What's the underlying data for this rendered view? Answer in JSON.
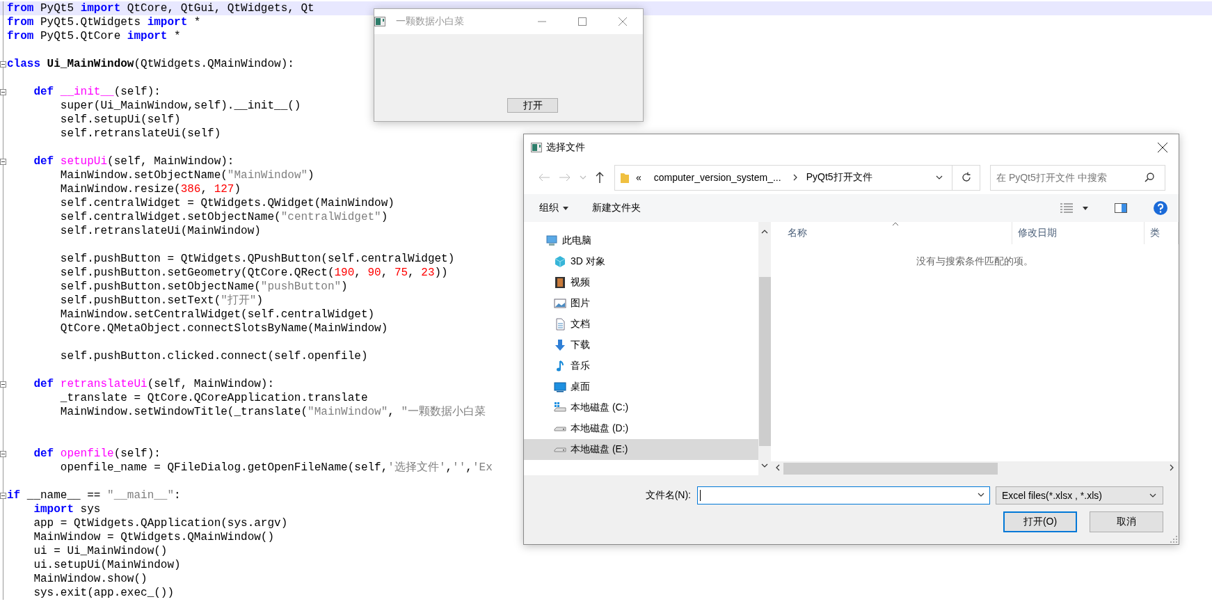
{
  "editor": {
    "lines": [
      {
        "current": true,
        "fold": false,
        "segments": [
          {
            "kind": "keyword",
            "text": "from"
          },
          {
            "kind": "plain",
            "text": " PyQt5 "
          },
          {
            "kind": "keyword",
            "text": "import"
          },
          {
            "kind": "plain",
            "text": " QtCore, QtGui, QtWidgets, Qt"
          }
        ]
      },
      {
        "current": false,
        "fold": false,
        "segments": [
          {
            "kind": "keyword",
            "text": "from"
          },
          {
            "kind": "plain",
            "text": " PyQt5.QtWidgets "
          },
          {
            "kind": "keyword",
            "text": "import"
          },
          {
            "kind": "plain",
            "text": " *"
          }
        ]
      },
      {
        "current": false,
        "fold": false,
        "segments": [
          {
            "kind": "keyword",
            "text": "from"
          },
          {
            "kind": "plain",
            "text": " PyQt5.QtCore "
          },
          {
            "kind": "keyword",
            "text": "import"
          },
          {
            "kind": "plain",
            "text": " *"
          }
        ]
      },
      {
        "current": false,
        "fold": false
      },
      {
        "current": false,
        "fold": true,
        "segments": [
          {
            "kind": "keyword",
            "text": "class "
          },
          {
            "kind": "classname",
            "text": "Ui_MainWindow"
          },
          {
            "kind": "plain",
            "text": "(QtWidgets.QMainWindow):"
          }
        ]
      },
      {
        "current": false,
        "fold": false
      },
      {
        "current": false,
        "fold": true,
        "segments": [
          {
            "kind": "keyword",
            "text": "    def "
          },
          {
            "kind": "function",
            "text": "__init__"
          },
          {
            "kind": "plain",
            "text": "(self):"
          }
        ]
      },
      {
        "current": false,
        "fold": false,
        "segments": [
          {
            "kind": "plain",
            "text": "        super(Ui_MainWindow,self).__init__()"
          }
        ]
      },
      {
        "current": false,
        "fold": false,
        "segments": [
          {
            "kind": "plain",
            "text": "        self.setupUi(self)"
          }
        ]
      },
      {
        "current": false,
        "fold": false,
        "segments": [
          {
            "kind": "plain",
            "text": "        self.retranslateUi(self)"
          }
        ]
      },
      {
        "current": false,
        "fold": false
      },
      {
        "current": false,
        "fold": true,
        "segments": [
          {
            "kind": "keyword",
            "text": "    def "
          },
          {
            "kind": "function",
            "text": "setupUi"
          },
          {
            "kind": "plain",
            "text": "(self, MainWindow):"
          }
        ]
      },
      {
        "current": false,
        "fold": false,
        "segments": [
          {
            "kind": "plain",
            "text": "        MainWindow.setObjectName("
          },
          {
            "kind": "string",
            "text": "\"MainWindow\""
          },
          {
            "kind": "plain",
            "text": ")"
          }
        ]
      },
      {
        "current": false,
        "fold": false,
        "segments": [
          {
            "kind": "plain",
            "text": "        MainWindow.resize("
          },
          {
            "kind": "number",
            "text": "386"
          },
          {
            "kind": "plain",
            "text": ", "
          },
          {
            "kind": "number",
            "text": "127"
          },
          {
            "kind": "plain",
            "text": ")"
          }
        ]
      },
      {
        "current": false,
        "fold": false,
        "segments": [
          {
            "kind": "plain",
            "text": "        self.centralWidget = QtWidgets.QWidget(MainWindow)"
          }
        ]
      },
      {
        "current": false,
        "fold": false,
        "segments": [
          {
            "kind": "plain",
            "text": "        self.centralWidget.setObjectName("
          },
          {
            "kind": "string",
            "text": "\"centralWidget\""
          },
          {
            "kind": "plain",
            "text": ")"
          }
        ]
      },
      {
        "current": false,
        "fold": false,
        "segments": [
          {
            "kind": "plain",
            "text": "        self.retranslateUi(MainWindow)"
          }
        ]
      },
      {
        "current": false,
        "fold": false
      },
      {
        "current": false,
        "fold": false,
        "segments": [
          {
            "kind": "plain",
            "text": "        self.pushButton = QtWidgets.QPushButton(self.centralWidget)"
          }
        ]
      },
      {
        "current": false,
        "fold": false,
        "segments": [
          {
            "kind": "plain",
            "text": "        self.pushButton.setGeometry(QtCore.QRect("
          },
          {
            "kind": "number",
            "text": "190"
          },
          {
            "kind": "plain",
            "text": ", "
          },
          {
            "kind": "number",
            "text": "90"
          },
          {
            "kind": "plain",
            "text": ", "
          },
          {
            "kind": "number",
            "text": "75"
          },
          {
            "kind": "plain",
            "text": ", "
          },
          {
            "kind": "number",
            "text": "23"
          },
          {
            "kind": "plain",
            "text": "))"
          }
        ]
      },
      {
        "current": false,
        "fold": false,
        "segments": [
          {
            "kind": "plain",
            "text": "        self.pushButton.setObjectName("
          },
          {
            "kind": "string",
            "text": "\"pushButton\""
          },
          {
            "kind": "plain",
            "text": ")"
          }
        ]
      },
      {
        "current": false,
        "fold": false,
        "segments": [
          {
            "kind": "plain",
            "text": "        self.pushButton.setText("
          },
          {
            "kind": "string",
            "text": "\"打开\""
          },
          {
            "kind": "plain",
            "text": ")"
          }
        ]
      },
      {
        "current": false,
        "fold": false,
        "segments": [
          {
            "kind": "plain",
            "text": "        MainWindow.setCentralWidget(self.centralWidget)"
          }
        ]
      },
      {
        "current": false,
        "fold": false,
        "segments": [
          {
            "kind": "plain",
            "text": "        QtCore.QMetaObject.connectSlotsByName(MainWindow)"
          }
        ]
      },
      {
        "current": false,
        "fold": false
      },
      {
        "current": false,
        "fold": false,
        "segments": [
          {
            "kind": "plain",
            "text": "        self.pushButton.clicked.connect(self.openfile)"
          }
        ]
      },
      {
        "current": false,
        "fold": false
      },
      {
        "current": false,
        "fold": true,
        "segments": [
          {
            "kind": "keyword",
            "text": "    def "
          },
          {
            "kind": "function",
            "text": "retranslateUi"
          },
          {
            "kind": "plain",
            "text": "(self, MainWindow):"
          }
        ]
      },
      {
        "current": false,
        "fold": false,
        "segments": [
          {
            "kind": "plain",
            "text": "        _translate = QtCore.QCoreApplication.translate"
          }
        ]
      },
      {
        "current": false,
        "fold": false,
        "segments": [
          {
            "kind": "plain",
            "text": "        MainWindow.setWindowTitle(_translate("
          },
          {
            "kind": "string",
            "text": "\"MainWindow\""
          },
          {
            "kind": "plain",
            "text": ", "
          },
          {
            "kind": "string",
            "text": "\"一颗数据小白菜"
          }
        ]
      },
      {
        "current": false,
        "fold": false
      },
      {
        "current": false,
        "fold": false
      },
      {
        "current": false,
        "fold": true,
        "segments": [
          {
            "kind": "keyword",
            "text": "    def "
          },
          {
            "kind": "function",
            "text": "openfile"
          },
          {
            "kind": "plain",
            "text": "(self):"
          }
        ]
      },
      {
        "current": false,
        "fold": false,
        "segments": [
          {
            "kind": "plain",
            "text": "        openfile_name = QFileDialog.getOpenFileName(self,"
          },
          {
            "kind": "string",
            "text": "'选择文件'"
          },
          {
            "kind": "plain",
            "text": ","
          },
          {
            "kind": "string",
            "text": "''"
          },
          {
            "kind": "plain",
            "text": ","
          },
          {
            "kind": "string",
            "text": "'Ex"
          }
        ]
      },
      {
        "current": false,
        "fold": false
      },
      {
        "current": false,
        "fold": true,
        "segments": [
          {
            "kind": "keyword",
            "text": "if"
          },
          {
            "kind": "plain",
            "text": " __name__ == "
          },
          {
            "kind": "string",
            "text": "\"__main__\""
          },
          {
            "kind": "plain",
            "text": ":"
          }
        ]
      },
      {
        "current": false,
        "fold": false,
        "segments": [
          {
            "kind": "keyword",
            "text": "    import"
          },
          {
            "kind": "plain",
            "text": " sys"
          }
        ]
      },
      {
        "current": false,
        "fold": false,
        "segments": [
          {
            "kind": "plain",
            "text": "    app = QtWidgets.QApplication(sys.argv)"
          }
        ]
      },
      {
        "current": false,
        "fold": false,
        "segments": [
          {
            "kind": "plain",
            "text": "    MainWindow = QtWidgets.QMainWindow()"
          }
        ]
      },
      {
        "current": false,
        "fold": false,
        "segments": [
          {
            "kind": "plain",
            "text": "    ui = Ui_MainWindow()"
          }
        ]
      },
      {
        "current": false,
        "fold": false,
        "segments": [
          {
            "kind": "plain",
            "text": "    ui.setupUi(MainWindow)"
          }
        ]
      },
      {
        "current": false,
        "fold": false,
        "segments": [
          {
            "kind": "plain",
            "text": "    MainWindow.show()"
          }
        ]
      },
      {
        "current": false,
        "fold": false,
        "segments": [
          {
            "kind": "plain",
            "text": "    sys.exit(app.exec_())"
          }
        ]
      }
    ]
  },
  "app_window": {
    "title": "一颗数据小白菜",
    "button": "打开"
  },
  "file_dialog": {
    "title": "选择文件",
    "address": {
      "overflow": "«",
      "crumbs": [
        "computer_version_system_...",
        "PyQt5打开文件"
      ]
    },
    "search": {
      "placeholder": "在 PyQt5打开文件 中搜索"
    },
    "toolbar": [
      {
        "label": "组织",
        "dropdown": true
      },
      {
        "label": "新建文件夹",
        "dropdown": false
      }
    ],
    "nav": [
      {
        "label": "此电脑",
        "selected": false,
        "children": [
          {
            "label": "3D 对象",
            "selected": false
          },
          {
            "label": "视频",
            "selected": false
          },
          {
            "label": "图片",
            "selected": false
          },
          {
            "label": "文档",
            "selected": false
          },
          {
            "label": "下载",
            "selected": false
          },
          {
            "label": "音乐",
            "selected": false
          },
          {
            "label": "桌面",
            "selected": false
          },
          {
            "label": "本地磁盘 (C:)",
            "selected": false
          },
          {
            "label": "本地磁盘 (D:)",
            "selected": false
          },
          {
            "label": "本地磁盘 (E:)",
            "selected": true
          }
        ]
      }
    ],
    "columns": [
      "名称",
      "修改日期",
      "类"
    ],
    "empty_message": "没有与搜索条件匹配的项。",
    "filename_label": "文件名(N):",
    "filetype": "Excel files(*.xlsx , *.xls)",
    "buttons": [
      {
        "label": "打开(O)",
        "default": true
      },
      {
        "label": "取消",
        "default": false
      }
    ]
  }
}
